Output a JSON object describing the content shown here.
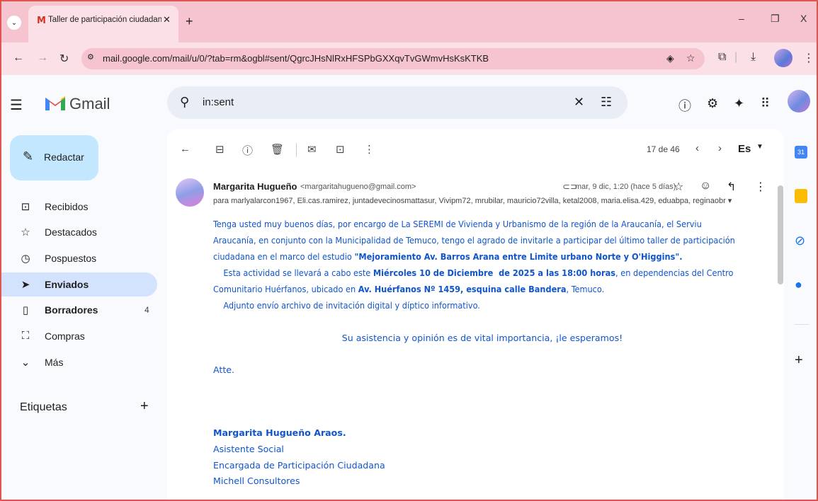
{
  "browser": {
    "tab_title": "Taller de participación ciudadan",
    "tab_favicon": "M",
    "new_tab": "+",
    "url": "mail.google.com/mail/u/0/?tab=rm&ogbl#sent/QgrcJHsNlRxHFSPbGXXqvTvGWmvHsKsKTKB",
    "win_min": "–",
    "win_restore": "❐",
    "win_close": "X"
  },
  "gmail": {
    "app_name": "Gmail",
    "search_value": "in:sent",
    "compose_label": "Redactar",
    "nav": [
      {
        "label": "Recibidos",
        "icon": "inbox-icon",
        "glyph": "⊡"
      },
      {
        "label": "Destacados",
        "icon": "star-icon",
        "glyph": "☆"
      },
      {
        "label": "Pospuestos",
        "icon": "clock-icon",
        "glyph": "◷"
      },
      {
        "label": "Enviados",
        "icon": "send-icon",
        "glyph": "➤",
        "active": true
      },
      {
        "label": "Borradores",
        "icon": "draft-icon",
        "glyph": "▯",
        "count": "4"
      },
      {
        "label": "Compras",
        "icon": "shopping-bag-icon",
        "glyph": "⛶"
      },
      {
        "label": "Más",
        "icon": "chevron-down-icon",
        "glyph": "⌄"
      }
    ],
    "labels_heading": "Etiquetas",
    "labels_add": "+"
  },
  "toolbar": {
    "pager": "17 de 46",
    "language": "Es"
  },
  "message": {
    "sender_name": "Margarita Hugueño",
    "sender_email": "<margaritahugueno@gmail.com>",
    "date": "mar, 9 dic, 1:20 (hace 5 días)",
    "recipients": "para marlyalarcon1967, Eli.cas.ramirez, juntadevecinosmattasur, Vivipm72, mrubilar, mauricio72villa, ketal2008, maria.elisa.429, eduabpa, reginaobr ▾",
    "p1_line1": "Tenga usted muy buenos días, por encargo de La SEREMI de Vivienda y Urbanismo de la región de la Araucanía, el Serviu",
    "p1_line2": "Araucanía, en conjunto con la Municipalidad de Temuco, tengo el agrado de invitarle a participar del último taller de participación",
    "p1_line3_pre": "ciudadana en el marco del estudio ",
    "p1_line3_bold": "\"Mejoramiento Av. Barros Arana entre Limite urbano Norte y O'Higgins\".",
    "p2_line1_pre": "    Esta actividad se llevará a cabo este ",
    "p2_line1_bold": "Miércoles 10 de Diciembre  de 2025 a las 18:00 horas",
    "p2_line1_post": ", en dependencias del Centro",
    "p2_line2_pre": "Comunitario Huérfanos, ubicado en ",
    "p2_line2_bold": "Av. Huérfanos Nº 1459, esquina calle Bandera",
    "p2_line2_post": ", Temuco.",
    "p3": "    Adjunto envío archivo de invitación digital y díptico informativo.",
    "center": "Su asistencia y opinión es de vital importancia, ¡le esperamos!",
    "closing": "Atte.",
    "sig_name": "Margarita Hugueño Araos.",
    "sig_title": "Asistente Social",
    "sig_role": "Encargada de Participación Ciudadana",
    "sig_company": "Michell Consultores"
  },
  "colors": {
    "chrome_pink": "#f5c4cf",
    "body_blue": "#1155cc",
    "compose_bg": "#c2e7ff",
    "active_nav": "#d3e3fd"
  }
}
